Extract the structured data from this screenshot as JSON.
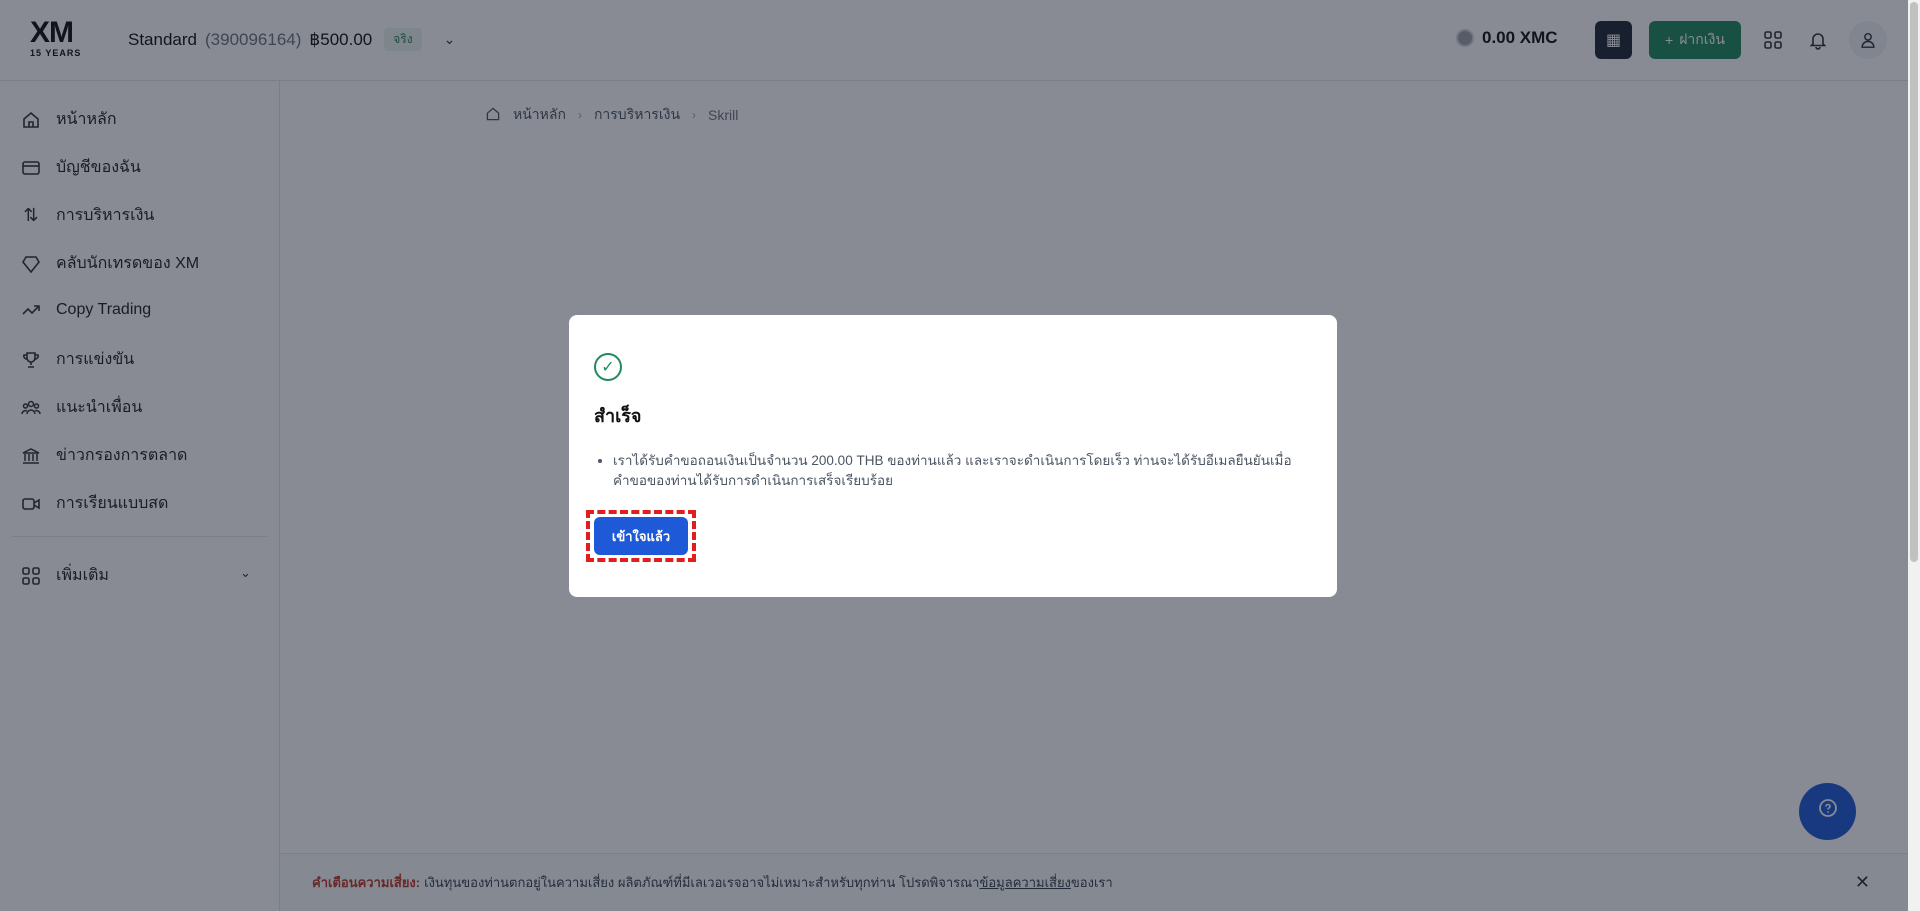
{
  "header": {
    "logo_text": "XM",
    "logo_sub": "15 YEARS",
    "account_name": "Standard",
    "account_number": "(390096164)",
    "balance": "฿500.00",
    "account_type_badge": "จริง",
    "xmc_balance": "0.00 XMC",
    "deposit_label": "ฝากเงิน",
    "icons": [
      "qr-code-icon",
      "plus-icon",
      "apps-grid-icon",
      "bell-icon",
      "user-icon"
    ]
  },
  "sidebar": {
    "items": [
      {
        "label": "หน้าหลัก",
        "icon": "home-icon"
      },
      {
        "label": "บัญชีของฉัน",
        "icon": "card-icon"
      },
      {
        "label": "การบริหารเงิน",
        "icon": "transfer-icon"
      },
      {
        "label": "คลับนักเทรดของ XM",
        "icon": "diamond-icon"
      },
      {
        "label": "Copy Trading",
        "icon": "trending-up-icon"
      },
      {
        "label": "การแข่งขัน",
        "icon": "trophy-icon"
      },
      {
        "label": "แนะนำเพื่อน",
        "icon": "users-icon"
      },
      {
        "label": "ข่าวกรองการตลาด",
        "icon": "bank-icon"
      },
      {
        "label": "การเรียนแบบสด",
        "icon": "video-icon"
      }
    ],
    "more_label": "เพิ่มเติม"
  },
  "breadcrumb": {
    "items": [
      "หน้าหลัก",
      "การบริหารเงิน",
      "Skrill"
    ]
  },
  "modal": {
    "title": "สำเร็จ",
    "message": "เราได้รับคำขอถอนเงินเป็นจำนวน 200.00 THB ของท่านแล้ว และเราจะดำเนินการโดยเร็ว ท่านจะได้รับอีเมลยืนยันเมื่อคำขอของท่านได้รับการดำเนินการเสร็จเรียบร้อย",
    "confirm_label": "เข้าใจแล้ว"
  },
  "risk_warning": {
    "label": "คำเตือนความเสี่ยง:",
    "text": "เงินทุนของท่านตกอยู่ในความเสี่ยง ผลิตภัณฑ์ที่มีเลเวอเรจอาจไม่เหมาะสำหรับทุกท่าน โปรดพิจารณา",
    "link": "ข้อมูลความเสี่ยง",
    "suffix": "ของเรา"
  },
  "colors": {
    "brand_green": "#1f8a5e",
    "primary_blue": "#1e5ad7",
    "highlight_red": "#e11d1d",
    "overlay": "rgba(17,24,39,0.5)"
  }
}
